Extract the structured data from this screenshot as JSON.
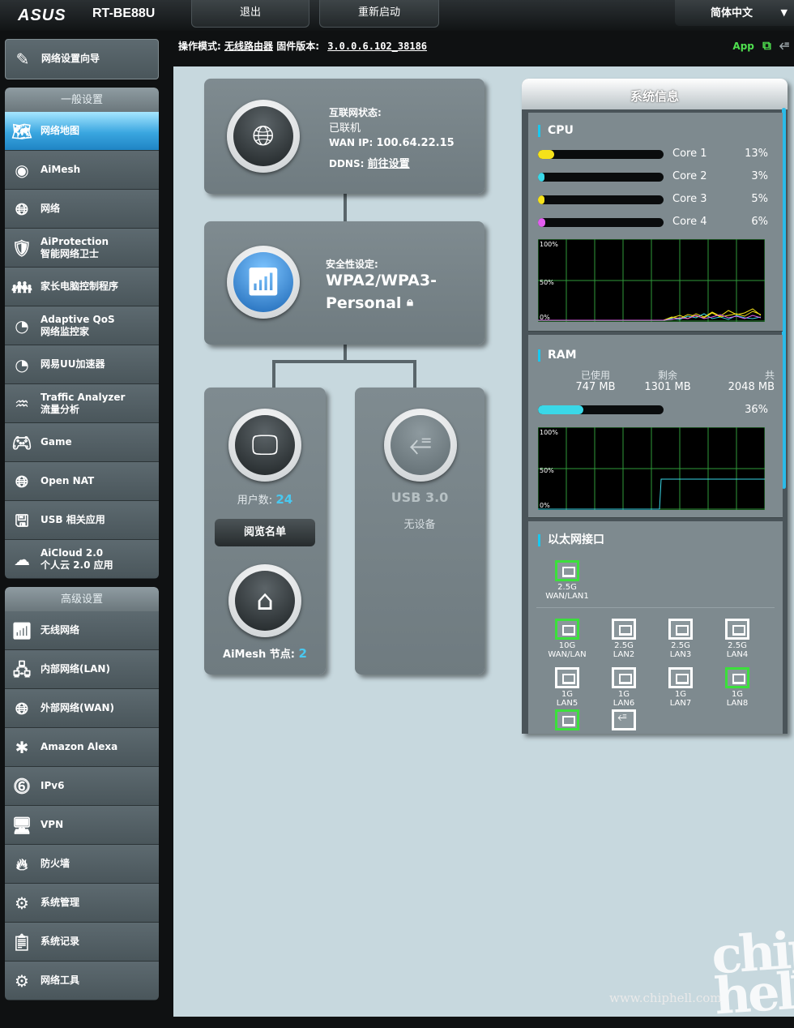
{
  "header": {
    "brand": "ASUS",
    "model": "RT-BE88U",
    "logout": "退出",
    "reboot": "重新启动",
    "language": "简体中文"
  },
  "infobar": {
    "mode_label": "操作模式:",
    "mode_value": "无线路由器",
    "fw_label": "固件版本:",
    "fw_value": "3.0.0.6.102_38186",
    "app": "App"
  },
  "sidebar": {
    "wizard": "网络设置向导",
    "general_title": "一般设置",
    "general": [
      {
        "label": "网络地图",
        "sub": ""
      },
      {
        "label": "AiMesh",
        "sub": ""
      },
      {
        "label": "网络",
        "sub": ""
      },
      {
        "label": "AiProtection",
        "sub": "智能网络卫士"
      },
      {
        "label": "家长电脑控制程序",
        "sub": ""
      },
      {
        "label": "Adaptive QoS",
        "sub": "网络监控家"
      },
      {
        "label": "网易UU加速器",
        "sub": ""
      },
      {
        "label": "Traffic Analyzer",
        "sub": "流量分析"
      },
      {
        "label": "Game",
        "sub": ""
      },
      {
        "label": "Open NAT",
        "sub": ""
      },
      {
        "label": "USB 相关应用",
        "sub": ""
      },
      {
        "label": "AiCloud 2.0",
        "sub": "个人云 2.0 应用"
      }
    ],
    "advanced_title": "高级设置",
    "advanced": [
      {
        "label": "无线网络",
        "sub": ""
      },
      {
        "label": "内部网络(LAN)",
        "sub": ""
      },
      {
        "label": "外部网络(WAN)",
        "sub": ""
      },
      {
        "label": "Amazon Alexa",
        "sub": ""
      },
      {
        "label": "IPv6",
        "sub": ""
      },
      {
        "label": "VPN",
        "sub": ""
      },
      {
        "label": "防火墙",
        "sub": ""
      },
      {
        "label": "系统管理",
        "sub": ""
      },
      {
        "label": "系统记录",
        "sub": ""
      },
      {
        "label": "网络工具",
        "sub": ""
      }
    ]
  },
  "internet": {
    "status_label": "互联网状态:",
    "status_value": "已联机",
    "wan_ip_label": "WAN IP:",
    "wan_ip": "100.64.22.15",
    "ddns_label": "DDNS:",
    "ddns_link": "前往设置"
  },
  "security": {
    "label": "安全性设定:",
    "value_line1": "WPA2/WPA3-",
    "value_line2": "Personal"
  },
  "clients": {
    "label": "用户数:",
    "count": "24",
    "button": "阅览名单",
    "aimesh_label": "AiMesh 节点:",
    "aimesh_count": "2"
  },
  "usb": {
    "label": "USB 3.0",
    "status": "无设备"
  },
  "sysinfo": {
    "title": "系统信息",
    "cpu_title": "CPU",
    "cores": [
      {
        "name": "Core 1",
        "pct": "13%",
        "value": 13,
        "color": "#f5e11a"
      },
      {
        "name": "Core 2",
        "pct": "3%",
        "value": 3,
        "color": "#3ad8e8"
      },
      {
        "name": "Core 3",
        "pct": "5%",
        "value": 5,
        "color": "#f5e11a"
      },
      {
        "name": "Core 4",
        "pct": "6%",
        "value": 6,
        "color": "#e35ef0"
      }
    ],
    "graph_ticks": [
      "100%",
      "50%",
      "0%"
    ],
    "ram_title": "RAM",
    "ram_used_label": "已使用",
    "ram_used": "747 MB",
    "ram_free_label": "剩余",
    "ram_free": "1301 MB",
    "ram_total_label": "共",
    "ram_total": "2048 MB",
    "ram_pct": "36%",
    "ram_value": 36,
    "eth_title": "以太网接口",
    "wan_port": {
      "speed": "2.5G",
      "name": "WAN/LAN1"
    },
    "ports": [
      {
        "speed": "10G",
        "name": "WAN/LAN",
        "active": true
      },
      {
        "speed": "2.5G",
        "name": "LAN2",
        "active": false
      },
      {
        "speed": "2.5G",
        "name": "LAN3",
        "active": false
      },
      {
        "speed": "2.5G",
        "name": "LAN4",
        "active": false
      },
      {
        "speed": "1G",
        "name": "LAN5",
        "active": false
      },
      {
        "speed": "1G",
        "name": "LAN6",
        "active": false
      },
      {
        "speed": "1G",
        "name": "LAN7",
        "active": false
      },
      {
        "speed": "1G",
        "name": "LAN8",
        "active": true
      }
    ]
  },
  "watermark": {
    "url": "www.chiphell.com",
    "logo": "chip hell"
  }
}
